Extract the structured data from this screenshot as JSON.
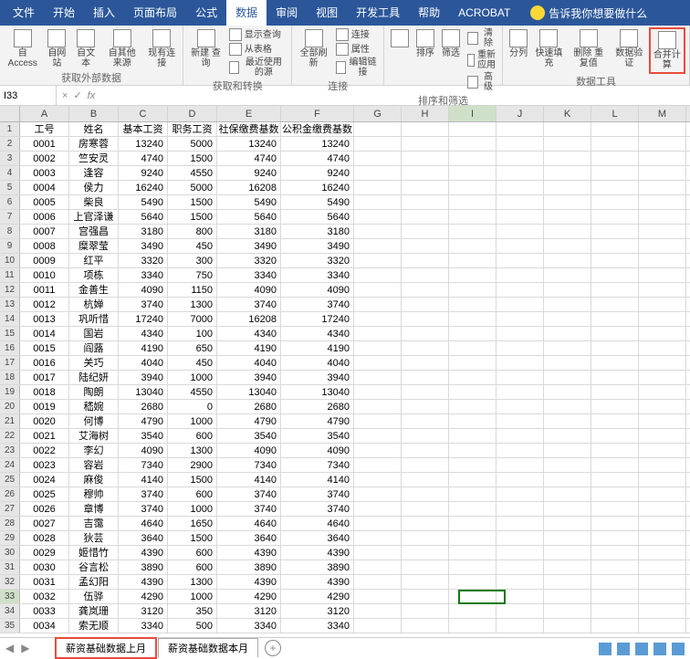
{
  "tabs": [
    "文件",
    "开始",
    "插入",
    "页面布局",
    "公式",
    "数据",
    "审阅",
    "视图",
    "开发工具",
    "帮助",
    "ACROBAT"
  ],
  "active_tab": "数据",
  "tell_me": "告诉我你想要做什么",
  "ribbon": {
    "g1": {
      "label": "获取外部数据",
      "items": [
        "自 Access",
        "自网站",
        "自文本",
        "自其他来源",
        "现有连接"
      ]
    },
    "g2": {
      "label": "获取和转换",
      "items": [
        "新建\n查询",
        "显示查询",
        "从表格",
        "最近使用的源"
      ]
    },
    "g3": {
      "label": "连接",
      "items": [
        "全部刷新",
        "连接",
        "属性",
        "编辑链接"
      ]
    },
    "g4": {
      "label": "排序和筛选",
      "items": [
        "排序",
        "筛选",
        "清除",
        "重新应用",
        "高级"
      ]
    },
    "g5": {
      "label": "数据工具",
      "items": [
        "分列",
        "快速填充",
        "删除\n重复值",
        "数据验\n证",
        "合并计算"
      ]
    }
  },
  "name_box": "I33",
  "headers": [
    "工号",
    "姓名",
    "基本工资",
    "职务工资",
    "社保缴费基数",
    "公积金缴费基数"
  ],
  "cols": [
    "A",
    "B",
    "C",
    "D",
    "E",
    "F",
    "G",
    "H",
    "I",
    "J",
    "K",
    "L",
    "M"
  ],
  "rows": [
    [
      "0001",
      "房寒蓉",
      "13240",
      "5000",
      "13240",
      "13240"
    ],
    [
      "0002",
      "竺安灵",
      "4740",
      "1500",
      "4740",
      "4740"
    ],
    [
      "0003",
      "逢容",
      "9240",
      "4550",
      "9240",
      "9240"
    ],
    [
      "0004",
      "侯力",
      "16240",
      "5000",
      "16208",
      "16240"
    ],
    [
      "0005",
      "柴良",
      "5490",
      "1500",
      "5490",
      "5490"
    ],
    [
      "0006",
      "上官泽谦",
      "5640",
      "1500",
      "5640",
      "5640"
    ],
    [
      "0007",
      "宫强昌",
      "3180",
      "800",
      "3180",
      "3180"
    ],
    [
      "0008",
      "糜翠莹",
      "3490",
      "450",
      "3490",
      "3490"
    ],
    [
      "0009",
      "红平",
      "3320",
      "300",
      "3320",
      "3320"
    ],
    [
      "0010",
      "项栋",
      "3340",
      "750",
      "3340",
      "3340"
    ],
    [
      "0011",
      "金善生",
      "4090",
      "1150",
      "4090",
      "4090"
    ],
    [
      "0012",
      "杭婵",
      "3740",
      "1300",
      "3740",
      "3740"
    ],
    [
      "0013",
      "巩听惜",
      "17240",
      "7000",
      "16208",
      "17240"
    ],
    [
      "0014",
      "国岩",
      "4340",
      "100",
      "4340",
      "4340"
    ],
    [
      "0015",
      "阎蕗",
      "4190",
      "650",
      "4190",
      "4190"
    ],
    [
      "0016",
      "关巧",
      "4040",
      "450",
      "4040",
      "4040"
    ],
    [
      "0017",
      "陆纪妍",
      "3940",
      "1000",
      "3940",
      "3940"
    ],
    [
      "0018",
      "陶朗",
      "13040",
      "4550",
      "13040",
      "13040"
    ],
    [
      "0019",
      "嵇婉",
      "2680",
      "0",
      "2680",
      "2680"
    ],
    [
      "0020",
      "何博",
      "4790",
      "1000",
      "4790",
      "4790"
    ],
    [
      "0021",
      "艾海树",
      "3540",
      "600",
      "3540",
      "3540"
    ],
    [
      "0022",
      "李幻",
      "4090",
      "1300",
      "4090",
      "4090"
    ],
    [
      "0023",
      "容岩",
      "7340",
      "2900",
      "7340",
      "7340"
    ],
    [
      "0024",
      "麻俊",
      "4140",
      "1500",
      "4140",
      "4140"
    ],
    [
      "0025",
      "穆帅",
      "3740",
      "600",
      "3740",
      "3740"
    ],
    [
      "0026",
      "章博",
      "3740",
      "1000",
      "3740",
      "3740"
    ],
    [
      "0027",
      "吉霭",
      "4640",
      "1650",
      "4640",
      "4640"
    ],
    [
      "0028",
      "狄芸",
      "3640",
      "1500",
      "3640",
      "3640"
    ],
    [
      "0029",
      "姬惜竹",
      "4390",
      "600",
      "4390",
      "4390"
    ],
    [
      "0030",
      "谷言松",
      "3890",
      "600",
      "3890",
      "3890"
    ],
    [
      "0031",
      "孟幻阳",
      "4390",
      "1300",
      "4390",
      "4390"
    ],
    [
      "0032",
      "伍骅",
      "4290",
      "1000",
      "4290",
      "4290"
    ],
    [
      "0033",
      "龚岚珊",
      "3120",
      "350",
      "3120",
      "3120"
    ],
    [
      "0034",
      "索无顺",
      "3340",
      "500",
      "3340",
      "3340"
    ]
  ],
  "sheets": {
    "active": "薪资基础数据上月",
    "other": "薪资基础数据本月"
  },
  "selected": {
    "col": "I",
    "row": 33
  }
}
